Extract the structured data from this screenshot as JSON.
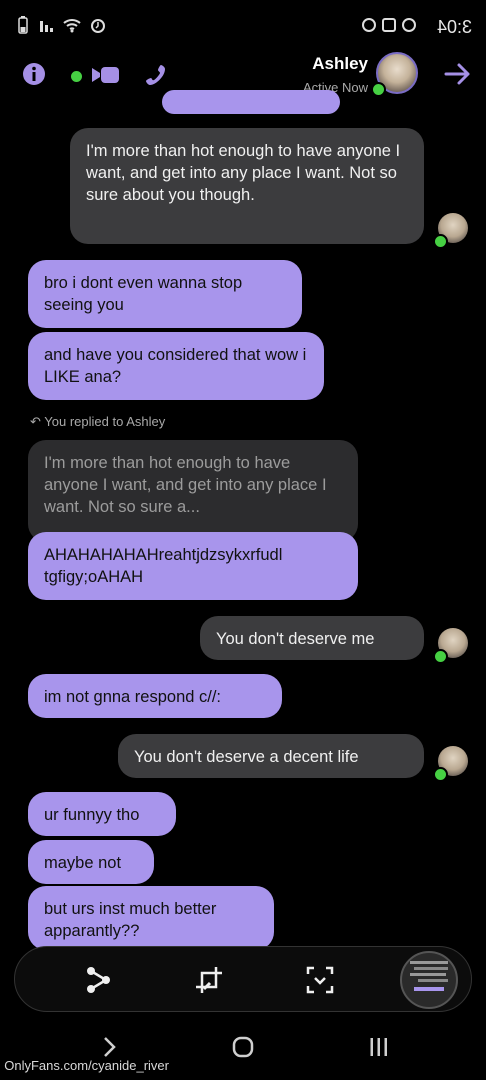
{
  "status_bar": {
    "time": "3:04"
  },
  "header": {
    "contact_name": "Ashley",
    "status": "Active Now"
  },
  "messages": {
    "m0": "I'm more than hot enough to have anyone I want, and get into any place I want. Not so sure about you though.",
    "m1": "bro i dont even wanna stop seeing you",
    "m2": "and have you considered that wow i LIKE ana?",
    "reply_label": "You replied to Ashley",
    "reply_quote": "I'm more than hot enough to have anyone I want, and get into any place I want. Not so sure a...",
    "m3": "AHAHAHAHAHreahtjdzsykxrfudl tgfigy;oAHAH",
    "m4": "You don't deserve me",
    "m5": "im not gnna respond c//:",
    "m6": "You don't deserve a decent life",
    "m7": "ur funnyy tho",
    "m8": "maybe not",
    "m9": "but urs inst much better apparantly??"
  },
  "watermark": "OnlyFans.com/cyanide_river",
  "colors": {
    "accent": "#a590e6",
    "outgoing_bubble": "#a895ec",
    "incoming_bubble": "#3c3c3e",
    "online": "#46d043"
  },
  "icons": [
    "info-icon",
    "video-call-icon",
    "phone-icon",
    "back-arrow-icon",
    "share-icon",
    "crop-icon",
    "scan-icon",
    "recents-icon",
    "home-icon",
    "back-icon"
  ]
}
